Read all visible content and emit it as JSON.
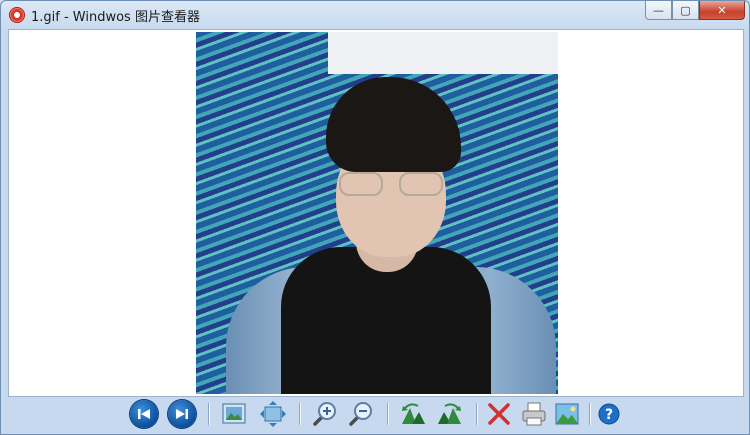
{
  "window": {
    "title": "1.gif - Windwos 图片查看器",
    "controls": {
      "minimize": "—",
      "maximize": "▢",
      "close": "✕"
    }
  },
  "image": {
    "subject": "photo-of-person"
  },
  "toolbar": {
    "buttons": [
      {
        "name": "previous-button",
        "icon": "skip-back-icon"
      },
      {
        "name": "next-button",
        "icon": "skip-forward-icon"
      },
      {
        "name": "fit-to-window-button",
        "icon": "fit-window-icon"
      },
      {
        "name": "actual-size-button",
        "icon": "actual-size-icon"
      },
      {
        "name": "zoom-in-button",
        "icon": "zoom-in-icon"
      },
      {
        "name": "zoom-out-button",
        "icon": "zoom-out-icon"
      },
      {
        "name": "rotate-left-button",
        "icon": "rotate-left-icon"
      },
      {
        "name": "rotate-right-button",
        "icon": "rotate-right-icon"
      },
      {
        "name": "delete-button",
        "icon": "delete-icon"
      },
      {
        "name": "print-button",
        "icon": "printer-icon"
      },
      {
        "name": "set-wallpaper-button",
        "icon": "picture-icon"
      },
      {
        "name": "help-button",
        "icon": "help-icon"
      }
    ]
  },
  "colors": {
    "nav_blue": "#1565c0",
    "delete_red": "#d32f2f",
    "help_blue": "#1e6fc8"
  }
}
